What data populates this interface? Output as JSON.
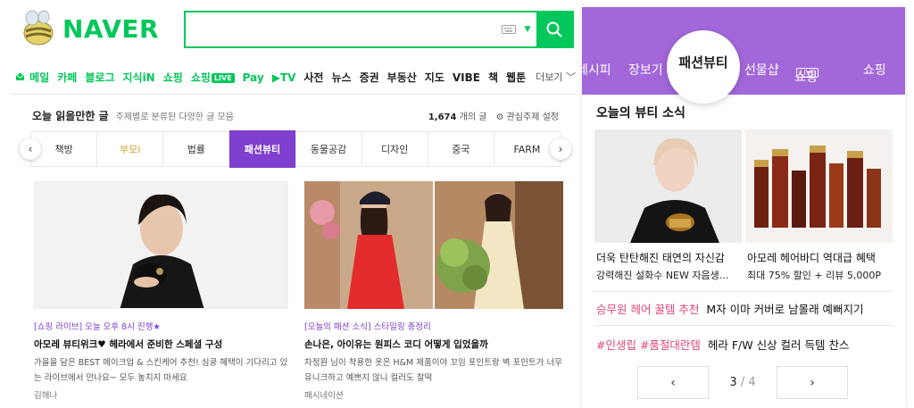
{
  "header": {
    "logo_text": "NAVER",
    "search": {
      "value": "",
      "placeholder": ""
    }
  },
  "services": [
    {
      "label": "메일",
      "color": "green"
    },
    {
      "label": "카페",
      "color": "green"
    },
    {
      "label": "블로그",
      "color": "green"
    },
    {
      "label": "지식iN",
      "color": "green"
    },
    {
      "label": "쇼핑",
      "color": "green"
    },
    {
      "label": "쇼핑",
      "color": "green",
      "badge": "LIVE"
    },
    {
      "label": "Pay",
      "color": "green"
    },
    {
      "label": "▶TV",
      "color": "green"
    },
    {
      "label": "사전",
      "color": "dark"
    },
    {
      "label": "뉴스",
      "color": "dark"
    },
    {
      "label": "증권",
      "color": "dark"
    },
    {
      "label": "부동산",
      "color": "dark"
    },
    {
      "label": "지도",
      "color": "dark"
    },
    {
      "label": "VIBE",
      "color": "dark"
    },
    {
      "label": "책",
      "color": "dark"
    },
    {
      "label": "웹툰",
      "color": "dark"
    }
  ],
  "services_more": "더보기 ﹀",
  "section": {
    "title": "오늘 읽을만한 글",
    "subtitle": "주제별로 분류된 다양한 글 모음",
    "count": "1,674",
    "count_suffix": "개의 글",
    "settings": "관심주제 설정"
  },
  "tabs": [
    {
      "label": "책방",
      "state": "normal"
    },
    {
      "label": "부모i",
      "state": "gold"
    },
    {
      "label": "법률",
      "state": "normal"
    },
    {
      "label": "패션뷰티",
      "state": "active"
    },
    {
      "label": "동물공감",
      "state": "normal"
    },
    {
      "label": "디자인",
      "state": "normal"
    },
    {
      "label": "중국",
      "state": "normal"
    },
    {
      "label": "FARM",
      "state": "normal"
    }
  ],
  "cards": [
    {
      "tag": "[쇼핑 라이브] 오늘 오후 8시 진행★",
      "title": "아모레 뷰티위크♥ 헤라에서 준비한 스페셜 구성",
      "desc": "가을을 담은 BEST 메이크업 & 스킨케어 추천! 심쿵 혜택이 기다리고 있는 라이브에서 만나요~ 모두 놓치지 마세요",
      "source": "김해나"
    },
    {
      "tag": "[오늘의 패션 소식] 스타일링 총정리",
      "title": "손나은, 아이유는 원피스 코디 어떻게 입었을까",
      "desc": "차정원 님이 착용한 옷은 H&M 제품이야 꼬임 포인트랑 벽 포인트가 너무 유니크하고 예쁘지 않니 컬러도 찰떡",
      "source": "패시네이션"
    }
  ],
  "right": {
    "nav": [
      "레시피",
      "장보기",
      "패션뷰티",
      "선물샵",
      "쇼핑",
      "쇼핑"
    ],
    "nav_live_badge": "LIVE",
    "title": "오늘의 뷰티 소식",
    "captions": [
      {
        "title": "더욱 탄탄해진 태연의 자신감",
        "sub": "강력해진 설화수 NEW 자음생..."
      },
      {
        "title": "아모레 헤어바디 역대급 혜택",
        "sub": "최대 75% 할인 + 리뷰 5,000P"
      }
    ],
    "rows": [
      {
        "highlight": "승무원 헤어 꿀템 추천",
        "text": "M자 이마 커버로 남몰래 예뻐지기"
      },
      {
        "highlight": "#인생립 #품절대란템",
        "text": "헤라 F/W 신상 컬러 득템 찬스"
      }
    ],
    "pager": {
      "current": "3",
      "sep": "/",
      "total": "4"
    }
  },
  "colors": {
    "naver_green": "#03c75a",
    "purple_active": "#7f3fcf",
    "purple_header": "#a267d9",
    "pink": "#e0457b",
    "gold": "#c9a227"
  }
}
